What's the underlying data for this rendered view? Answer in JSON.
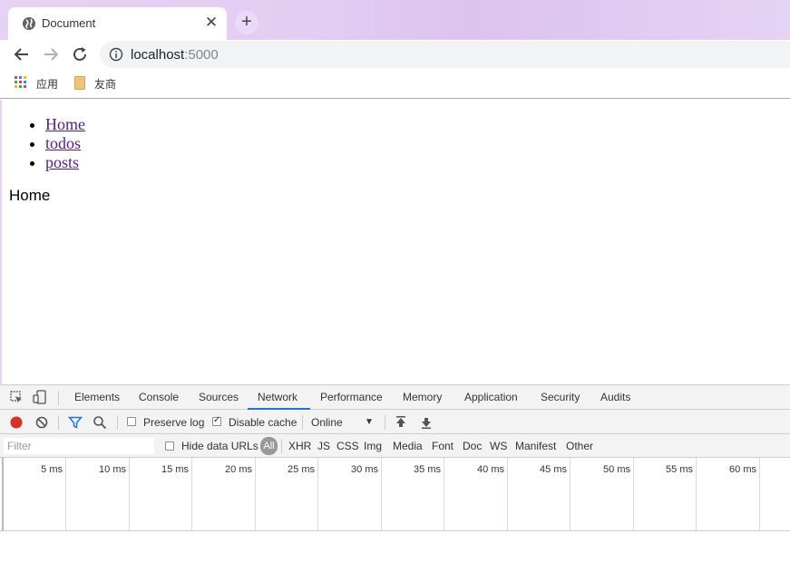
{
  "browser": {
    "tab_title": "Document",
    "tab_close": "✕",
    "new_tab": "+",
    "url_host": "localhost",
    "url_port": ":5000",
    "bookmarks": [
      "应用",
      "友商"
    ]
  },
  "page": {
    "nav": [
      "Home",
      "todos",
      "posts"
    ],
    "heading": "Home"
  },
  "devtools": {
    "tabs": [
      "Elements",
      "Console",
      "Sources",
      "Network",
      "Performance",
      "Memory",
      "Application",
      "Security",
      "Audits"
    ],
    "active_tab": "Network",
    "toolbar": {
      "preserve_log": "Preserve log",
      "preserve_log_checked": false,
      "disable_cache": "Disable cache",
      "disable_cache_checked": true,
      "throttling": "Online"
    },
    "filter": {
      "placeholder": "Filter",
      "hide_data_urls": "Hide data URLs",
      "types": [
        "All",
        "XHR",
        "JS",
        "CSS",
        "Img",
        "Media",
        "Font",
        "Doc",
        "WS",
        "Manifest",
        "Other"
      ]
    },
    "timeline_ticks": [
      "5 ms",
      "10 ms",
      "15 ms",
      "20 ms",
      "25 ms",
      "30 ms",
      "35 ms",
      "40 ms",
      "45 ms",
      "50 ms",
      "55 ms",
      "60 ms"
    ]
  },
  "colors": {
    "record": "#d93025",
    "active_tab_underline": "#1a73e8",
    "filter_icon": "#1a73e8",
    "link": "#551a8b"
  }
}
